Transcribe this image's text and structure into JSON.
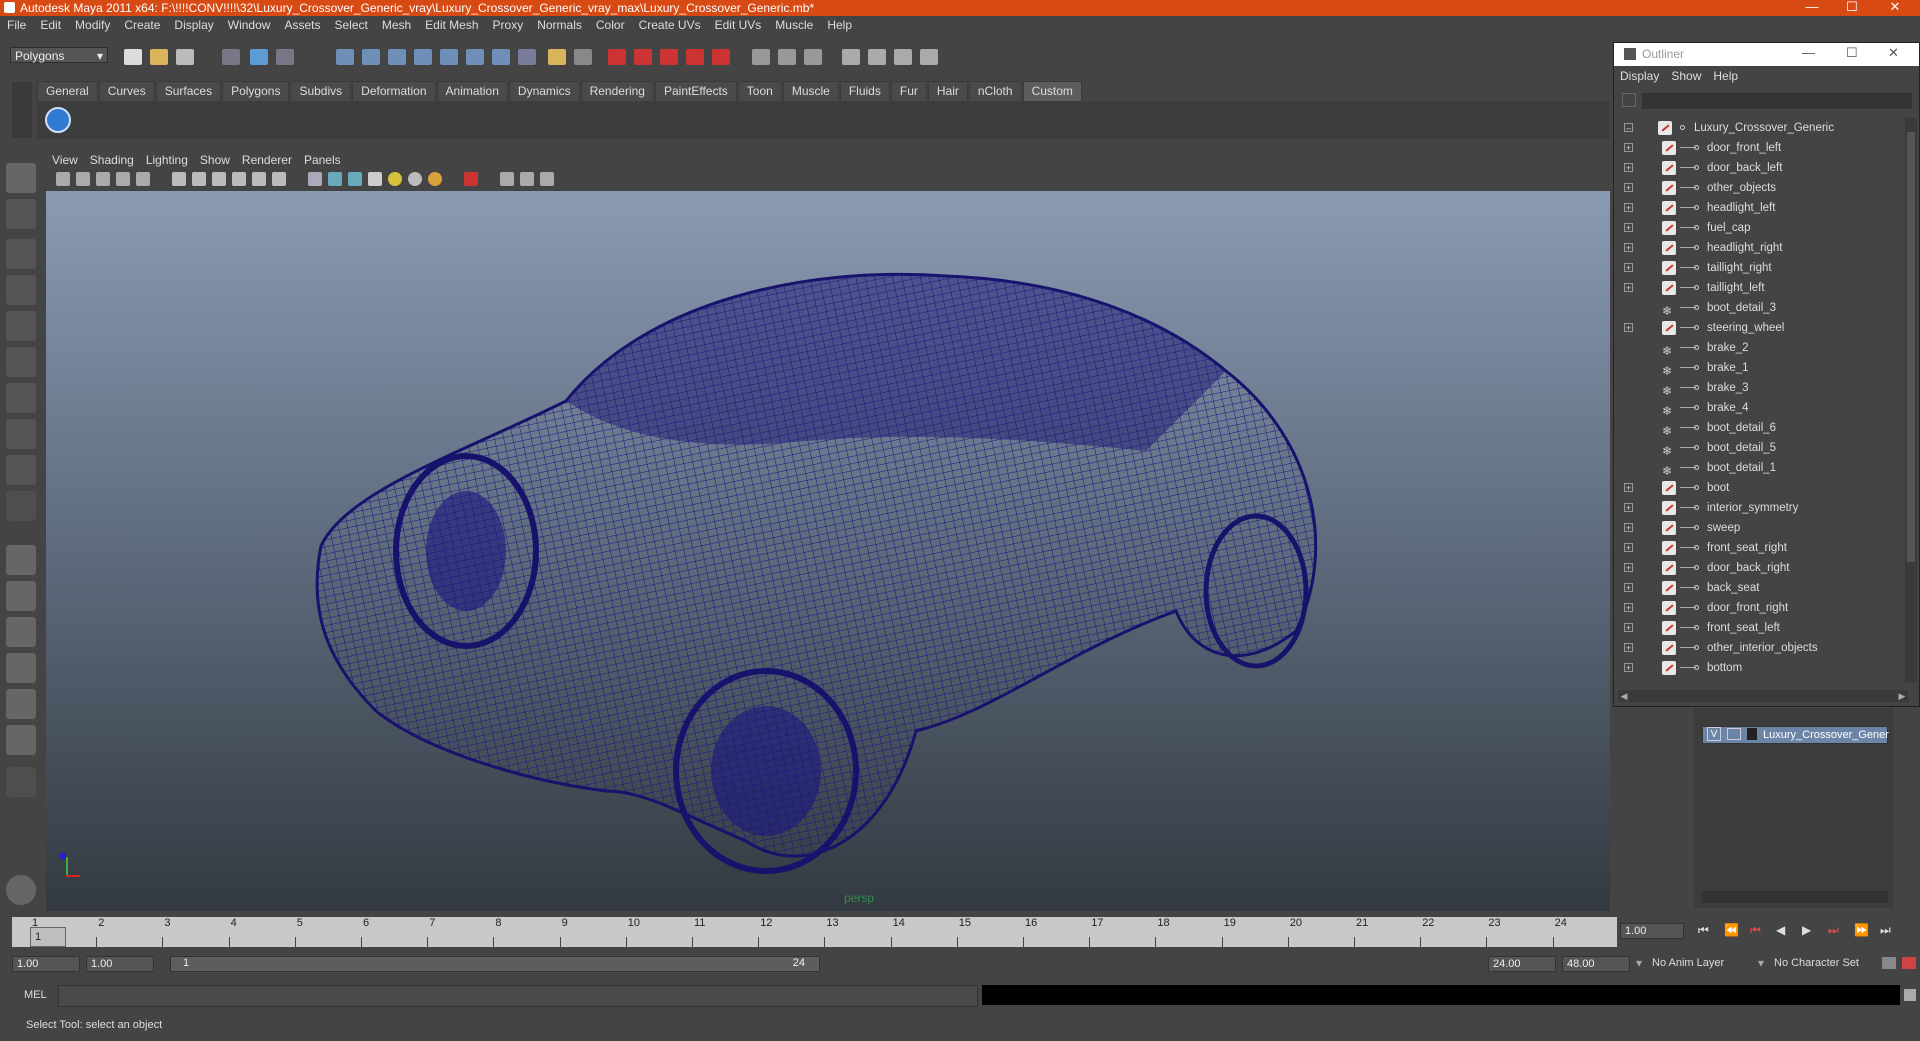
{
  "window": {
    "title": "Autodesk Maya 2011 x64: F:\\!!!!CONV!!!!\\32\\Luxury_Crossover_Generic_vray\\Luxury_Crossover_Generic_vray_max\\Luxury_Crossover_Generic.mb*",
    "title_bar_color": "#d84a13"
  },
  "menubar": [
    "File",
    "Edit",
    "Modify",
    "Create",
    "Display",
    "Window",
    "Assets",
    "Select",
    "Mesh",
    "Edit Mesh",
    "Proxy",
    "Normals",
    "Color",
    "Create UVs",
    "Edit UVs",
    "Muscle",
    "Help"
  ],
  "statusline": {
    "mode": "Polygons"
  },
  "shelf": {
    "tabs": [
      "General",
      "Curves",
      "Surfaces",
      "Polygons",
      "Subdivs",
      "Deformation",
      "Animation",
      "Dynamics",
      "Rendering",
      "PaintEffects",
      "Toon",
      "Muscle",
      "Fluids",
      "Fur",
      "Hair",
      "nCloth",
      "Custom"
    ],
    "active_tab": "Custom"
  },
  "viewport": {
    "menu": [
      "View",
      "Shading",
      "Lighting",
      "Show",
      "Renderer",
      "Panels"
    ],
    "camera_label": "persp",
    "wireframe_color": "#17126b"
  },
  "outliner": {
    "title": "Outliner",
    "menu": [
      "Display",
      "Show",
      "Help"
    ],
    "root": "Luxury_Crossover_Generic",
    "items": [
      {
        "name": "door_front_left",
        "expandable": true,
        "icon": "mesh"
      },
      {
        "name": "door_back_left",
        "expandable": true,
        "icon": "mesh"
      },
      {
        "name": "other_objects",
        "expandable": true,
        "icon": "mesh"
      },
      {
        "name": "headlight_left",
        "expandable": true,
        "icon": "mesh"
      },
      {
        "name": "fuel_cap",
        "expandable": true,
        "icon": "mesh"
      },
      {
        "name": "headlight_right",
        "expandable": true,
        "icon": "mesh"
      },
      {
        "name": "taillight_right",
        "expandable": true,
        "icon": "mesh"
      },
      {
        "name": "taillight_left",
        "expandable": true,
        "icon": "mesh"
      },
      {
        "name": "boot_detail_3",
        "expandable": false,
        "icon": "group"
      },
      {
        "name": "steering_wheel",
        "expandable": true,
        "icon": "mesh"
      },
      {
        "name": "brake_2",
        "expandable": false,
        "icon": "group"
      },
      {
        "name": "brake_1",
        "expandable": false,
        "icon": "group"
      },
      {
        "name": "brake_3",
        "expandable": false,
        "icon": "group"
      },
      {
        "name": "brake_4",
        "expandable": false,
        "icon": "group"
      },
      {
        "name": "boot_detail_6",
        "expandable": false,
        "icon": "group"
      },
      {
        "name": "boot_detail_5",
        "expandable": false,
        "icon": "group"
      },
      {
        "name": "boot_detail_1",
        "expandable": false,
        "icon": "group"
      },
      {
        "name": "boot",
        "expandable": true,
        "icon": "mesh"
      },
      {
        "name": "interior_symmetry",
        "expandable": true,
        "icon": "mesh"
      },
      {
        "name": "sweep",
        "expandable": true,
        "icon": "mesh"
      },
      {
        "name": "front_seat_right",
        "expandable": true,
        "icon": "mesh"
      },
      {
        "name": "door_back_right",
        "expandable": true,
        "icon": "mesh"
      },
      {
        "name": "back_seat",
        "expandable": true,
        "icon": "mesh"
      },
      {
        "name": "door_front_right",
        "expandable": true,
        "icon": "mesh"
      },
      {
        "name": "front_seat_left",
        "expandable": true,
        "icon": "mesh"
      },
      {
        "name": "other_interior_objects",
        "expandable": true,
        "icon": "mesh"
      },
      {
        "name": "bottom",
        "expandable": true,
        "icon": "mesh"
      }
    ]
  },
  "layers": {
    "layer_name": "Luxury_Crossover_Gener",
    "visibility": "V"
  },
  "timeslider": {
    "ticks": [
      "1",
      "2",
      "3",
      "4",
      "5",
      "6",
      "7",
      "8",
      "9",
      "10",
      "11",
      "12",
      "13",
      "14",
      "15",
      "16",
      "17",
      "18",
      "19",
      "20",
      "21",
      "22",
      "23",
      "24"
    ],
    "current_frame_marker": "1",
    "current_time": "1.00"
  },
  "range": {
    "start": "1.00",
    "playback_start": "1.00",
    "range_start_label": "1",
    "range_end_label": "24",
    "playback_end": "24.00",
    "end": "48.00",
    "anim_layer": "No Anim Layer",
    "character_set": "No Character Set"
  },
  "commandline": {
    "label": "MEL"
  },
  "helpline": {
    "text": "Select Tool: select an object"
  }
}
